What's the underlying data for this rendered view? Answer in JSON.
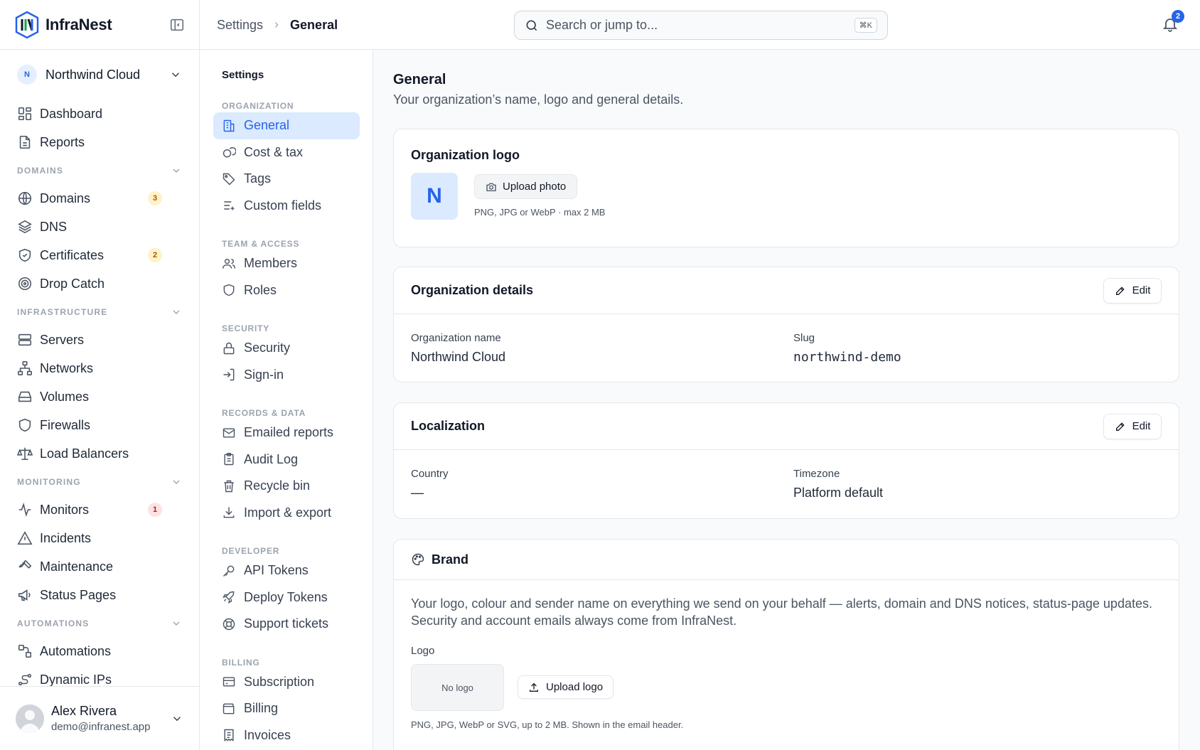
{
  "brand": {
    "name": "InfraNest"
  },
  "org": {
    "initial": "N",
    "name": "Northwind Cloud"
  },
  "sidebar": {
    "top_items": [
      {
        "label": "Dashboard",
        "icon": "dashboard-icon"
      },
      {
        "label": "Reports",
        "icon": "document-icon"
      }
    ],
    "domains": {
      "label": "DOMAINS",
      "items": [
        {
          "label": "Domains",
          "icon": "globe-icon",
          "badge": "3"
        },
        {
          "label": "DNS",
          "icon": "layers-icon"
        },
        {
          "label": "Certificates",
          "icon": "shield-check-icon",
          "badge": "2"
        },
        {
          "label": "Drop Catch",
          "icon": "target-icon"
        }
      ]
    },
    "infrastructure": {
      "label": "INFRASTRUCTURE",
      "items": [
        {
          "label": "Servers",
          "icon": "server-icon"
        },
        {
          "label": "Networks",
          "icon": "network-icon"
        },
        {
          "label": "Volumes",
          "icon": "drive-icon"
        },
        {
          "label": "Firewalls",
          "icon": "shield-icon"
        },
        {
          "label": "Load Balancers",
          "icon": "scale-icon"
        }
      ]
    },
    "monitoring": {
      "label": "MONITORING",
      "items": [
        {
          "label": "Monitors",
          "icon": "activity-icon",
          "badge": "1"
        },
        {
          "label": "Incidents",
          "icon": "warning-icon"
        },
        {
          "label": "Maintenance",
          "icon": "wrench-icon"
        },
        {
          "label": "Status Pages",
          "icon": "megaphone-icon"
        }
      ]
    },
    "automations": {
      "label": "AUTOMATIONS",
      "items": [
        {
          "label": "Automations",
          "icon": "workflow-icon"
        },
        {
          "label": "Dynamic IPs",
          "icon": "route-icon"
        }
      ]
    }
  },
  "user": {
    "name": "Alex Rivera",
    "email": "demo@infranest.app"
  },
  "topbar": {
    "breadcrumb": [
      "Settings",
      "General"
    ],
    "search_placeholder": "Search or jump to...",
    "search_shortcut": "⌘K",
    "notification_count": "2"
  },
  "settings_nav": {
    "title": "Settings",
    "sections": [
      {
        "label": "ORGANIZATION",
        "items": [
          {
            "label": "General",
            "icon": "building-icon",
            "active": true
          },
          {
            "label": "Cost & tax",
            "icon": "coins-icon"
          },
          {
            "label": "Tags",
            "icon": "tag-icon"
          },
          {
            "label": "Custom fields",
            "icon": "list-plus-icon"
          }
        ]
      },
      {
        "label": "TEAM & ACCESS",
        "items": [
          {
            "label": "Members",
            "icon": "users-icon"
          },
          {
            "label": "Roles",
            "icon": "shield-icon"
          }
        ]
      },
      {
        "label": "SECURITY",
        "items": [
          {
            "label": "Security",
            "icon": "lock-icon"
          },
          {
            "label": "Sign-in",
            "icon": "sign-in-icon"
          }
        ]
      },
      {
        "label": "RECORDS & DATA",
        "items": [
          {
            "label": "Emailed reports",
            "icon": "mail-icon"
          },
          {
            "label": "Audit Log",
            "icon": "clipboard-icon"
          },
          {
            "label": "Recycle bin",
            "icon": "trash-icon"
          },
          {
            "label": "Import & export",
            "icon": "download-icon"
          }
        ]
      },
      {
        "label": "DEVELOPER",
        "items": [
          {
            "label": "API Tokens",
            "icon": "key-icon"
          },
          {
            "label": "Deploy Tokens",
            "icon": "rocket-icon"
          },
          {
            "label": "Support tickets",
            "icon": "lifebuoy-icon"
          }
        ]
      },
      {
        "label": "BILLING",
        "items": [
          {
            "label": "Subscription",
            "icon": "credit-card-icon"
          },
          {
            "label": "Billing",
            "icon": "wallet-icon"
          },
          {
            "label": "Invoices",
            "icon": "receipt-icon"
          }
        ]
      }
    ]
  },
  "page": {
    "title": "General",
    "subtitle": "Your organization’s name, logo and general details."
  },
  "logo_card": {
    "title": "Organization logo",
    "initial": "N",
    "upload_label": "Upload photo",
    "hint": "PNG, JPG or WebP · max 2 MB"
  },
  "details_card": {
    "title": "Organization details",
    "edit_label": "Edit",
    "name_label": "Organization name",
    "name_value": "Northwind Cloud",
    "slug_label": "Slug",
    "slug_value": "northwind-demo"
  },
  "localization_card": {
    "title": "Localization",
    "edit_label": "Edit",
    "country_label": "Country",
    "country_value": "—",
    "timezone_label": "Timezone",
    "timezone_value": "Platform default"
  },
  "brand_card": {
    "title": "Brand",
    "description_1": "Your logo, colour and sender name on everything we send on your behalf — alerts, domain and DNS notices, status-page updates.",
    "description_2": "Security and account emails always come from InfraNest.",
    "logo_label": "Logo",
    "no_logo": "No logo",
    "upload_label": "Upload logo",
    "hint": "PNG, JPG, WebP or SVG, up to 2 MB. Shown in the email header."
  },
  "colors": {
    "accent": "#2563eb",
    "active_bg": "#dbeafe",
    "border": "#e5e7eb"
  }
}
